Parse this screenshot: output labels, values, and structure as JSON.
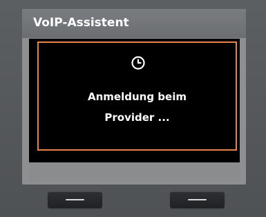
{
  "header": {
    "title": "VoIP-Assistent"
  },
  "dialog": {
    "icon": "clock-icon",
    "line1": "Anmeldung beim",
    "line2": "Provider ..."
  },
  "colors": {
    "accent_border": "#e8844a",
    "display_background": "#000000",
    "title_text": "#ffffff"
  },
  "softkeys": {
    "left_icon": "dash-icon",
    "right_icon": "dash-icon"
  }
}
